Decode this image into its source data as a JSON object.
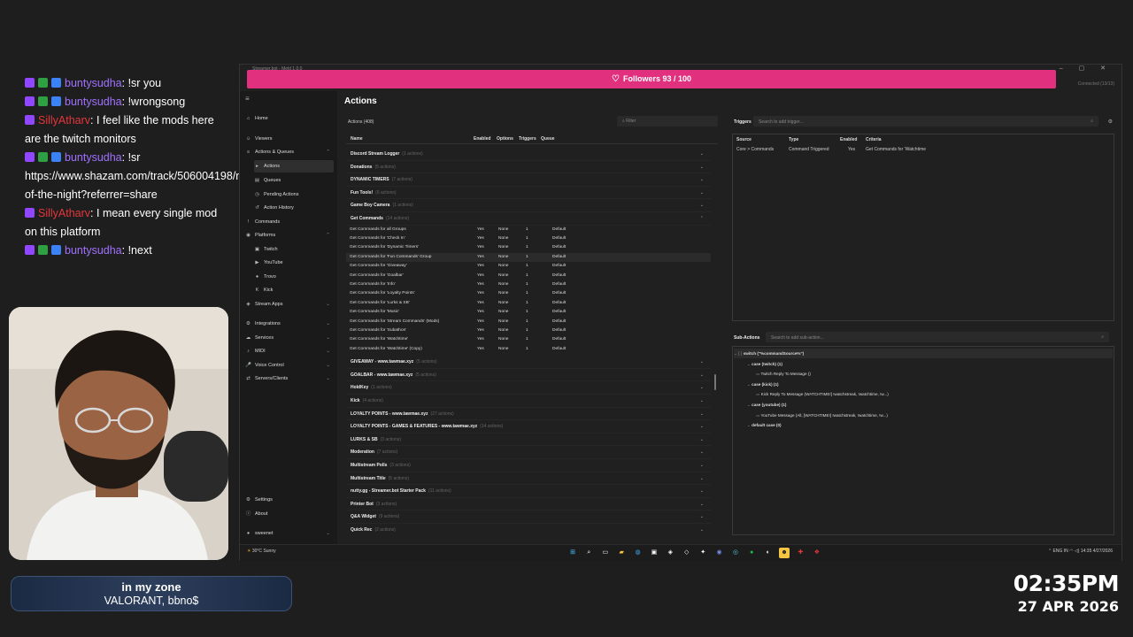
{
  "chat": [
    {
      "user": "buntysudha",
      "color": "#a071ff",
      "badges": [
        "purple",
        "green",
        "blue"
      ],
      "message": ": !sr you"
    },
    {
      "user": "buntysudha",
      "color": "#a071ff",
      "badges": [
        "purple",
        "green",
        "blue"
      ],
      "message": ": !wrongsong"
    },
    {
      "user": "SillyAtharv",
      "color": "#e5363c",
      "badges": [
        "purple"
      ],
      "message": ": I feel like the mods here are the twitch monitors"
    },
    {
      "user": "buntysudha",
      "color": "#a071ff",
      "badges": [
        "purple",
        "green",
        "blue"
      ],
      "message": ": !sr https://www.shazam.com/track/506004198/middle-of-the-night?referrer=share"
    },
    {
      "user": "SillyAtharv",
      "color": "#e5363c",
      "badges": [
        "purple"
      ],
      "message": ": I mean every single mod on this platform"
    },
    {
      "user": "buntysudha",
      "color": "#a071ff",
      "badges": [
        "purple",
        "green",
        "blue"
      ],
      "message": ": !next"
    }
  ],
  "now_playing": {
    "title": "in my zone",
    "subtitle": "VALORANT, bbno$"
  },
  "clock": {
    "time": "02:35PM",
    "date": "27 APR 2026"
  },
  "window": {
    "title": "Streamer.bot - Meld 1.0.0",
    "connected": "Connected (13/13)",
    "followers_goal": "Followers  93 / 100",
    "followers_value": 93,
    "followers_target": 100
  },
  "sidebar": {
    "items": [
      {
        "label": "Home",
        "icon": "⌂",
        "name": "home"
      },
      {
        "label": "Viewers",
        "icon": "☺",
        "name": "viewers"
      },
      {
        "label": "Actions & Queues",
        "icon": "≡",
        "name": "actions-queues",
        "chev": "⌃"
      },
      {
        "label": "Actions",
        "icon": "▸",
        "name": "actions",
        "sub": true,
        "active": true
      },
      {
        "label": "Queues",
        "icon": "▤",
        "name": "queues",
        "sub": true
      },
      {
        "label": "Pending Actions",
        "icon": "◷",
        "name": "pending-actions",
        "sub": true
      },
      {
        "label": "Action History",
        "icon": "↺",
        "name": "action-history",
        "sub": true
      },
      {
        "label": "Commands",
        "icon": "!",
        "name": "commands"
      },
      {
        "label": "Platforms",
        "icon": "◉",
        "name": "platforms",
        "chev": "⌃"
      },
      {
        "label": "Twitch",
        "icon": "▣",
        "name": "twitch",
        "sub": true
      },
      {
        "label": "YouTube",
        "icon": "▶",
        "name": "youtube",
        "sub": true
      },
      {
        "label": "Trovo",
        "icon": "●",
        "name": "trovo",
        "sub": true
      },
      {
        "label": "Kick",
        "icon": "K",
        "name": "kick",
        "sub": true
      },
      {
        "label": "Stream Apps",
        "icon": "◈",
        "name": "stream-apps",
        "chev": "⌄"
      },
      {
        "label": "Integrations",
        "icon": "⚙",
        "name": "integrations",
        "chev": "⌄"
      },
      {
        "label": "Services",
        "icon": "☁",
        "name": "services",
        "chev": "⌄"
      },
      {
        "label": "MIDI",
        "icon": "♪",
        "name": "midi",
        "chev": "⌄"
      },
      {
        "label": "Voice Control",
        "icon": "🎤",
        "name": "voice-control",
        "chev": "⌄"
      },
      {
        "label": "Servers/Clients",
        "icon": "⇄",
        "name": "servers-clients",
        "chev": "⌄"
      }
    ],
    "settings": "Settings",
    "about": "About",
    "user": "sweenet"
  },
  "main": {
    "page_title": "Actions",
    "actions_count": "Actions (408)",
    "filter_placeholder": "Filter",
    "columns": {
      "name": "Name",
      "enabled": "Enabled",
      "options": "Options",
      "triggers": "Triggers",
      "queue": "Queue"
    },
    "groups_before": [
      {
        "label": "Discord Stream Logger",
        "count": "(1 actions)"
      },
      {
        "label": "Donations",
        "count": "(5 actions)"
      },
      {
        "label": "DYNAMIC TIMERS",
        "count": "(7 actions)"
      },
      {
        "label": "Fun Tools!",
        "count": "(6 actions)"
      },
      {
        "label": "Game Boy Camera",
        "count": "(1 actions)"
      }
    ],
    "expanded_group": {
      "label": "Get Commands",
      "count": "(14 actions)"
    },
    "actions": [
      {
        "name": "Get Commands for all Groups",
        "enabled": "Yes",
        "options": "None",
        "triggers": "1",
        "queue": "Default"
      },
      {
        "name": "Get Commands for 'Check In'",
        "enabled": "Yes",
        "options": "None",
        "triggers": "1",
        "queue": "Default"
      },
      {
        "name": "Get Commands for 'Dynamic Timers'",
        "enabled": "Yes",
        "options": "None",
        "triggers": "1",
        "queue": "Default"
      },
      {
        "name": "Get Commands for 'Fun Commands' Group",
        "enabled": "Yes",
        "options": "None",
        "triggers": "1",
        "queue": "Default"
      },
      {
        "name": "Get Commands for 'Giveaway'",
        "enabled": "Yes",
        "options": "None",
        "triggers": "1",
        "queue": "Default"
      },
      {
        "name": "Get Commands for 'Goalbar'",
        "enabled": "Yes",
        "options": "None",
        "triggers": "1",
        "queue": "Default"
      },
      {
        "name": "Get Commands for 'Info'",
        "enabled": "Yes",
        "options": "None",
        "triggers": "1",
        "queue": "Default"
      },
      {
        "name": "Get Commands for 'Loyalty Points'",
        "enabled": "Yes",
        "options": "None",
        "triggers": "1",
        "queue": "Default"
      },
      {
        "name": "Get Commands for 'Lurks & SB'",
        "enabled": "Yes",
        "options": "None",
        "triggers": "1",
        "queue": "Default"
      },
      {
        "name": "Get Commands for 'Music'",
        "enabled": "Yes",
        "options": "None",
        "triggers": "1",
        "queue": "Default"
      },
      {
        "name": "Get Commands for 'Stream Commands' (Mods)",
        "enabled": "Yes",
        "options": "None",
        "triggers": "1",
        "queue": "Default"
      },
      {
        "name": "Get Commands for 'Subathon'",
        "enabled": "Yes",
        "options": "None",
        "triggers": "1",
        "queue": "Default"
      },
      {
        "name": "Get Commands for 'Watchtime'",
        "enabled": "Yes",
        "options": "None",
        "triggers": "1",
        "queue": "Default"
      },
      {
        "name": "Get Commands for 'Watchtime' (Copy)",
        "enabled": "Yes",
        "options": "None",
        "triggers": "1",
        "queue": "Default"
      }
    ],
    "groups_after": [
      {
        "label": "GIVEAWAY - www.tawmae.xyz",
        "count": "(5 actions)"
      },
      {
        "label": "GOALBAR - www.tawmae.xyz",
        "count": "(5 actions)"
      },
      {
        "label": "HoldKey",
        "count": "(1 actions)"
      },
      {
        "label": "Kick",
        "count": "(4 actions)"
      },
      {
        "label": "LOYALTY POINTS - www.tawmae.xyz",
        "count": "(27 actions)"
      },
      {
        "label": "LOYALTY POINTS - GAMES & FEATURES - www.tawmae.xyz",
        "count": "(14 actions)"
      },
      {
        "label": "LURKS & SB",
        "count": "(3 actions)"
      },
      {
        "label": "Moderation",
        "count": "(7 actions)"
      },
      {
        "label": "Multistream Polls",
        "count": "(3 actions)"
      },
      {
        "label": "Multistream Title",
        "count": "(5 actions)"
      },
      {
        "label": "nutty.gg - Streamer.bot Starter Pack",
        "count": "(11 actions)"
      },
      {
        "label": "Printer Bot",
        "count": "(3 actions)"
      },
      {
        "label": "Q&A Widget",
        "count": "(9 actions)"
      },
      {
        "label": "Quick Rec",
        "count": "(2 actions)"
      }
    ]
  },
  "triggers": {
    "label": "Triggers",
    "search_placeholder": "Search to add trigger...",
    "columns": {
      "source": "Source",
      "type": "Type",
      "enabled": "Enabled",
      "criteria": "Criteria"
    },
    "row": {
      "source": "Core > Commands",
      "type": "Command Triggered",
      "enabled": "Yes",
      "criteria": "Get Commands for 'Watchtime"
    }
  },
  "subactions": {
    "label": "Sub-Actions",
    "search_placeholder": "Search to add sub-action...",
    "nodes": [
      {
        "text": "switch (\"%commandSource%\")",
        "indent": 0,
        "bold": true
      },
      {
        "text": "case (twitch)  (1)",
        "indent": 1,
        "bold": true
      },
      {
        "text": "Twitch Reply To Message ()",
        "indent": 2
      },
      {
        "text": "case (kick)  (1)",
        "indent": 1,
        "bold": true
      },
      {
        "text": "Kick Reply To Message (WATCHTIME!] !watchstreak, !watchtime, !w...)",
        "indent": 2
      },
      {
        "text": "case (youtube)  (1)",
        "indent": 1,
        "bold": true
      },
      {
        "text": "YouTube Message (All, [WATCHTIME!] !watchstreak, !watchtime, !w...)",
        "indent": 2
      },
      {
        "text": "default case (0)",
        "indent": 1,
        "bold": true
      }
    ]
  },
  "taskbar": {
    "weather_temp": "30°C",
    "weather_desc": "Sunny",
    "lang": "ENG\nIN",
    "time": "14:35",
    "date": "4/27/2026"
  },
  "colors": {
    "accent": "#e0307e",
    "bg": "#1e1e1e"
  }
}
